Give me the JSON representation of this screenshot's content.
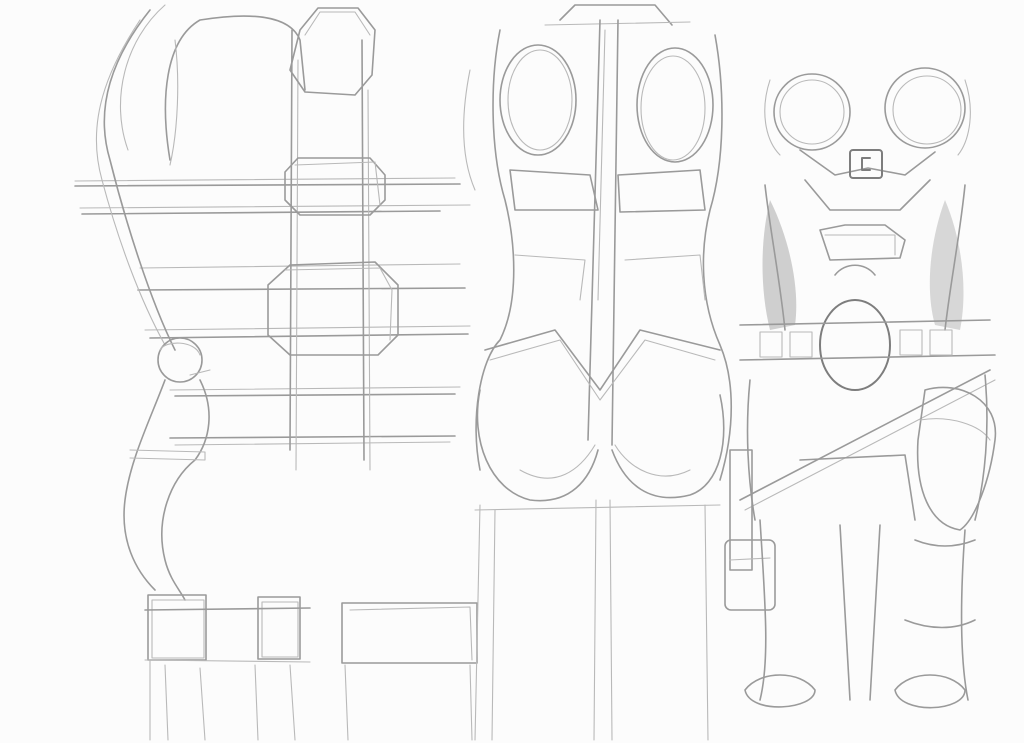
{
  "sheet": {
    "background": "#fcfcfc",
    "pencil_color": "#9a9a9a"
  },
  "sketches": [
    {
      "id": "construction-grid-sketch"
    },
    {
      "id": "torso-back-sketch"
    },
    {
      "id": "armored-torso-sketch"
    }
  ]
}
